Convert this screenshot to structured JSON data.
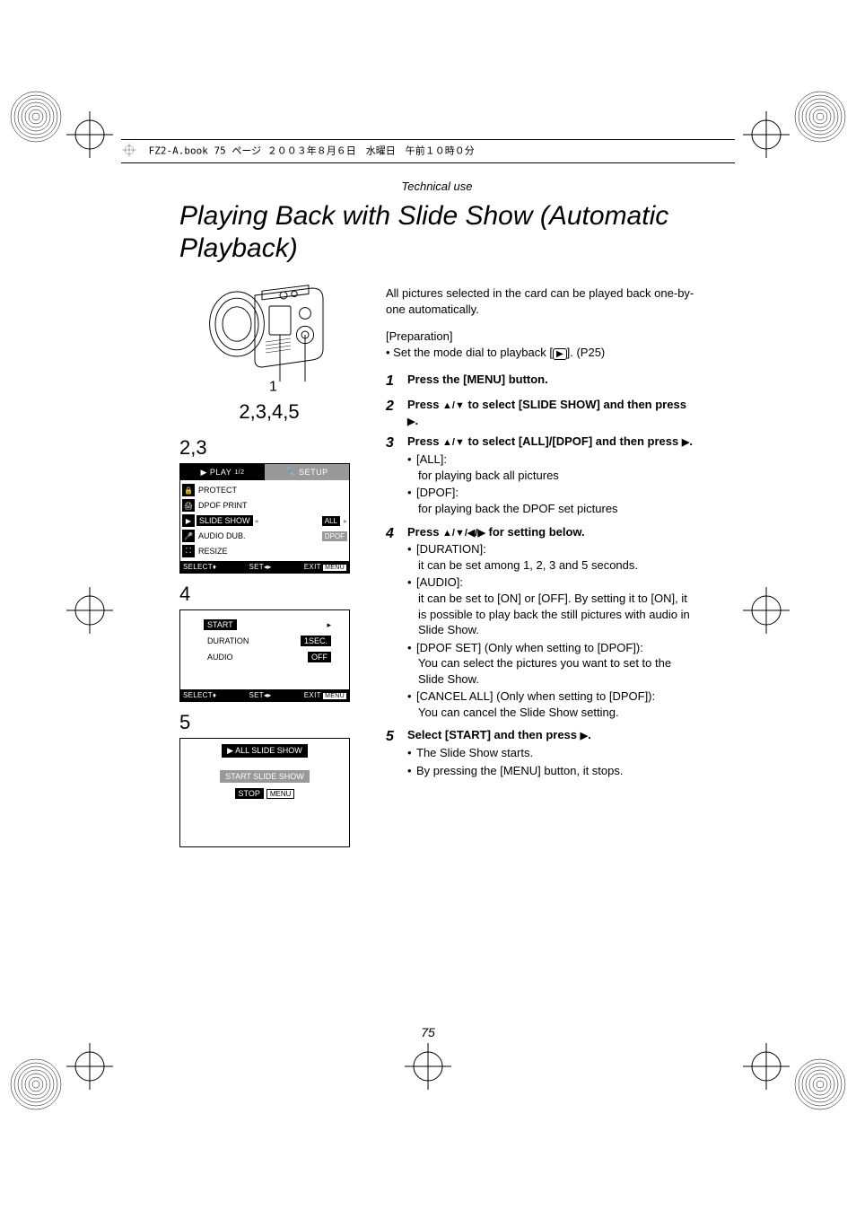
{
  "header": "FZ2-A.book  75 ページ  ２００３年８月６日　水曜日　午前１０時０分",
  "section": "Technical use",
  "title": "Playing Back with Slide Show (Automatic Playback)",
  "camera": {
    "callout1": "1",
    "callout2": "2,3,4,5"
  },
  "menuBlocks": {
    "b1_label": "2,3",
    "b2_label": "4",
    "b3_label": "5"
  },
  "lcd1": {
    "tab1_label": "PLAY",
    "tab1_frac": "1/2",
    "tab2_label": "SETUP",
    "r1": "PROTECT",
    "r2": "DPOF PRINT",
    "r3": "SLIDE SHOW",
    "r3v1": "ALL",
    "r4": "AUDIO DUB.",
    "r4v": "DPOF",
    "r5": "RESIZE",
    "f1": "SELECT",
    "f2": "SET",
    "f3": "EXIT",
    "f4": "MENU"
  },
  "lcd2": {
    "r1": "START",
    "r2": "DURATION",
    "r2v": "1SEC.",
    "r3": "AUDIO",
    "r3v": "OFF",
    "f1": "SELECT",
    "f2": "SET",
    "f3": "EXIT",
    "f4": "MENU"
  },
  "lcd3": {
    "l1": "ALL SLIDE SHOW",
    "l2": "START SLIDE SHOW",
    "l3a": "STOP",
    "l3b": "MENU"
  },
  "intro": "All pictures selected in the card can be played back one-by-one automatically.",
  "prep_label": "[Preparation]",
  "prep_text": "• Set the mode dial to playback [",
  "prep_text2": "]. (P25)",
  "steps": {
    "s1": "Press the [MENU] button.",
    "s2a": "Press ",
    "s2b": " to select [SLIDE SHOW] and then press ",
    "s2c": ".",
    "s3a": "Press ",
    "s3b": " to select [ALL]/[DPOF] and then press ",
    "s3c": ".",
    "s3_all_label": "[ALL]:",
    "s3_all_text": "for playing back all pictures",
    "s3_dpof_label": "[DPOF]:",
    "s3_dpof_text": "for playing back the DPOF set pictures",
    "s4a": "Press ",
    "s4b": " for setting below.",
    "s4_dur_label": "[DURATION]:",
    "s4_dur_text": "it can be set among 1, 2, 3 and 5 seconds.",
    "s4_aud_label": "[AUDIO]:",
    "s4_aud_text": "it can be set to [ON] or [OFF]. By setting it to [ON], it is possible to play back the still pictures with audio in Slide Show.",
    "s4_ds_label": "[DPOF SET] (Only when setting to [DPOF]):",
    "s4_ds_text": "You can select the pictures you want to set to the Slide Show.",
    "s4_ca_label": "[CANCEL ALL] (Only when setting to [DPOF]):",
    "s4_ca_text": "You can cancel the Slide Show setting.",
    "s5a": "Select [START] and then press ",
    "s5b": ".",
    "s5_t1": "The Slide Show starts.",
    "s5_t2": "By pressing the [MENU] button, it stops."
  },
  "pageNumber": "75"
}
